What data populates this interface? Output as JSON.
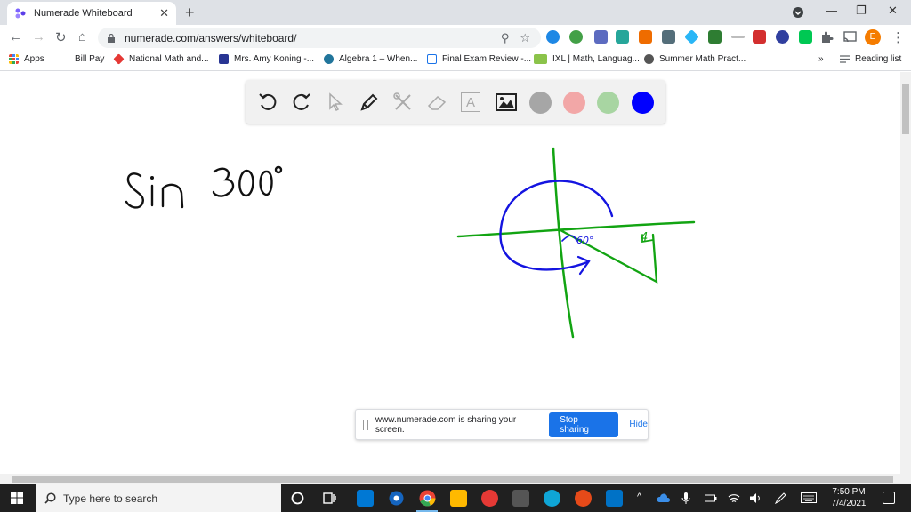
{
  "browser": {
    "tab_title": "Numerade Whiteboard",
    "url": "numerade.com/answers/whiteboard/",
    "close_glyph": "✕",
    "newtab_glyph": "+",
    "back_glyph": "←",
    "forward_glyph": "→",
    "reload_glyph": "↻",
    "home_glyph": "⌂",
    "zoom_glyph": "⚲",
    "star_glyph": "☆",
    "min_glyph": "—",
    "restore_glyph": "❐",
    "win_close_glyph": "✕",
    "profile_letter": "E",
    "menu_glyph": "⋮"
  },
  "bookmarks": {
    "items": [
      "Apps",
      "Bill Pay",
      "National Math and...",
      "Mrs. Amy Koning -...",
      "Algebra 1 – When...",
      "Final Exam Review -...",
      "IXL | Math, Languag...",
      "Summer Math Pract..."
    ],
    "overflow": "»",
    "reading_list": "Reading list"
  },
  "whiteboard": {
    "tools": [
      "undo-icon",
      "redo-icon",
      "pointer-icon",
      "pen-icon",
      "tools-icon",
      "eraser-icon",
      "text-icon",
      "image-icon"
    ],
    "text_tool_glyph": "A",
    "colors": [
      "#a6a6a6",
      "#f2a7a7",
      "#a8d5a2",
      "#0000ff"
    ],
    "handwriting": {
      "main_text": "Sin 300°",
      "angle_label": "60°",
      "side_label": "4"
    }
  },
  "share_bar": {
    "message": "www.numerade.com is sharing your screen.",
    "stop_label": "Stop sharing",
    "hide_label": "Hide"
  },
  "taskbar": {
    "search_placeholder": "Type here to search",
    "time": "7:50 PM",
    "date": "7/4/2021",
    "tray_up_glyph": "^"
  }
}
